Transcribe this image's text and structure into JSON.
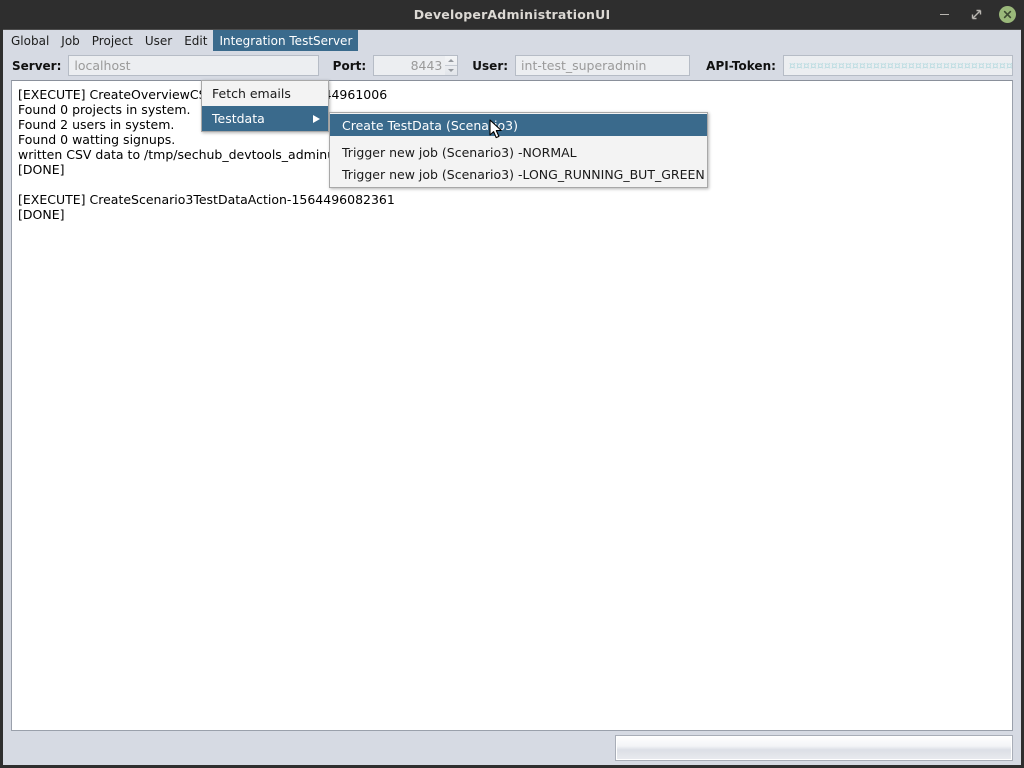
{
  "window": {
    "title": "DeveloperAdministrationUI",
    "controls": [
      {
        "name": "minimize",
        "glyph": "minimize-icon"
      },
      {
        "name": "maximize",
        "glyph": "maximize-icon"
      },
      {
        "name": "close",
        "glyph": "close-icon"
      }
    ]
  },
  "colors": {
    "titlebar_bg": "#2e2e2e",
    "titlebar_text": "#dcd9d4",
    "close_button": "#9ab87a",
    "menu_highlight": "#3a6a8c",
    "panel_bg": "#d6dae3",
    "field_bg": "#eceef1",
    "placeholder_text": "#9a9a9a",
    "token_text": "#b8dbe0",
    "console_bg": "#ffffff",
    "console_text": "#000000"
  },
  "menubar": {
    "items": [
      {
        "label": "Global",
        "active": false
      },
      {
        "label": "Job",
        "active": false
      },
      {
        "label": "Project",
        "active": false
      },
      {
        "label": "User",
        "active": false
      },
      {
        "label": "Edit",
        "active": false
      },
      {
        "label": "Integration TestServer",
        "active": true
      }
    ]
  },
  "menus": {
    "integration": {
      "items": [
        {
          "label": "Fetch emails",
          "highlight": false,
          "submenu": false
        },
        {
          "label": "Testdata",
          "highlight": true,
          "submenu": true
        }
      ]
    },
    "testdata": {
      "items": [
        {
          "label": "Create TestData (Scenario3)",
          "highlight": true
        },
        {
          "label": "Trigger new job (Scenario3) -NORMAL",
          "highlight": false
        },
        {
          "label": "Trigger new job (Scenario3) -LONG_RUNNING_BUT_GREEN",
          "highlight": false
        }
      ]
    }
  },
  "toolbar": {
    "server_label": "Server:",
    "server_value": "localhost",
    "port_label": "Port:",
    "port_value": "8443",
    "user_label": "User:",
    "user_value": "int-test_superadmin",
    "token_label": "API-Token:",
    "token_value": "¤¤¤¤¤¤¤¤¤¤¤¤¤¤¤¤¤¤¤¤¤¤¤¤¤¤¤¤¤¤¤¤¤¤"
  },
  "console": {
    "text": "[EXECUTE] CreateOverviewCSVExportAction-15644961006\nFound 0 projects in system.\nFound 2 users in system.\nFound 0 watting signups.\nwritten CSV data to /tmp/sechub_devtools_adminui_export1732174310176142559.csv\n[DONE]\n\n[EXECUTE] CreateScenario3TestDataAction-1564496082361\n[DONE]"
  },
  "statusbar": {
    "message": "",
    "progress_value": 0
  }
}
